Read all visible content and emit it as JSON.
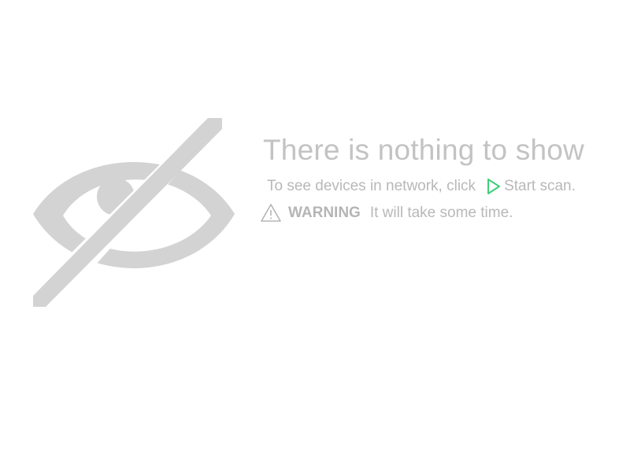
{
  "empty_state": {
    "illustration_icon": "eye-slash-icon",
    "headline": "There is nothing to show",
    "hint": {
      "text": "To see devices in network, click",
      "action_icon": "play-icon",
      "action_label": "Start scan."
    },
    "warning": {
      "icon": "warning-triangle-icon",
      "label": "WARNING",
      "text": "It will take some time."
    }
  },
  "colors": {
    "muted_gray": "#c3c3c3",
    "text_gray": "#b8b8b8",
    "accent_green": "#3ecf7a"
  }
}
